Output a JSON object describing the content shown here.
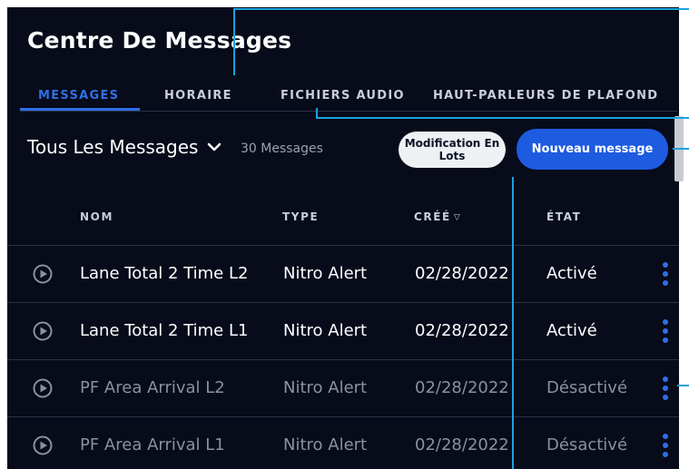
{
  "page": {
    "title": "Centre De Messages"
  },
  "tabs": [
    {
      "label": "MESSAGES",
      "active": true
    },
    {
      "label": "HORAIRE",
      "active": false
    },
    {
      "label": "FICHIERS AUDIO",
      "active": false
    },
    {
      "label": "HAUT-PARLEURS DE PLAFOND",
      "active": false
    }
  ],
  "toolbar": {
    "filter_label": "Tous Les Messages",
    "count_label": "30 Messages",
    "bulk_edit_label": "Modification En Lots",
    "new_message_label": "Nouveau message"
  },
  "table": {
    "columns": {
      "name": "NOM",
      "type": "TYPE",
      "created": "CRÉÉ",
      "state": "ÉTAT"
    },
    "rows": [
      {
        "name": "Lane Total 2 Time L2",
        "type": "Nitro Alert",
        "created": "02/28/2022",
        "state": "Activé"
      },
      {
        "name": "Lane Total 2 Time L1",
        "type": "Nitro Alert",
        "created": "02/28/2022",
        "state": "Activé"
      },
      {
        "name": "PF Area Arrival L2",
        "type": "Nitro Alert",
        "created": "02/28/2022",
        "state": "Désactivé"
      },
      {
        "name": "PF Area Arrival L1",
        "type": "Nitro Alert",
        "created": "02/28/2022",
        "state": "Désactivé"
      }
    ]
  },
  "colors": {
    "background": "#070b1a",
    "accent": "#2f6fe4",
    "primary_button": "#1d5be0",
    "annotation": "#1aa2e0"
  },
  "icons": {
    "play": "play-circle-icon",
    "more": "kebab-menu-icon",
    "chevron": "chevron-down-icon",
    "sort": "sort-desc-icon"
  }
}
